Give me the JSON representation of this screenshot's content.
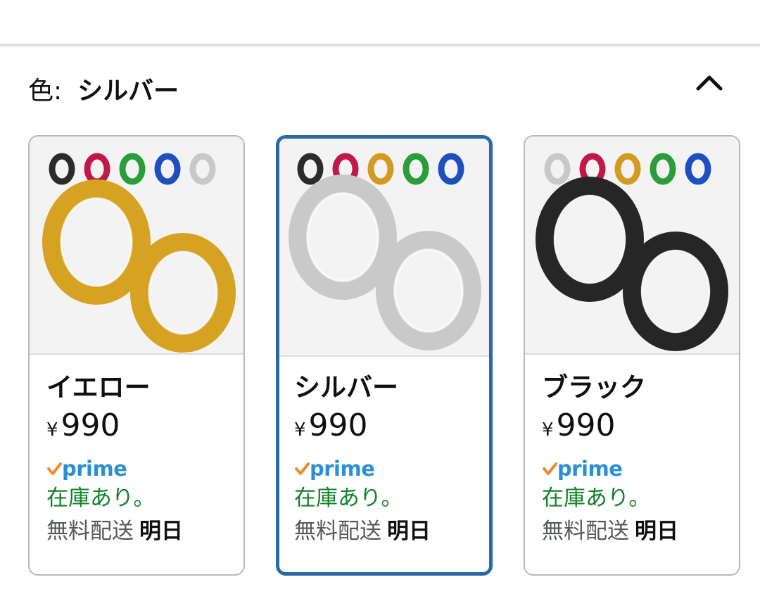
{
  "color_selector": {
    "label": "色:",
    "selected_value": "シルバー",
    "collapse_icon": "chevron-up-icon"
  },
  "variants": [
    {
      "name": "イエロー",
      "currency": "¥",
      "price": "990",
      "prime": "prime",
      "stock": "在庫あり。",
      "delivery_label": "無料配送",
      "delivery_date": "明日",
      "image_color": "#d6a222",
      "swatches": [
        "#2b2b2b",
        "#c0184a",
        "#2a9d3a",
        "#1f4fbf",
        "#c8c8c8"
      ]
    },
    {
      "name": "シルバー",
      "currency": "¥",
      "price": "990",
      "prime": "prime",
      "stock": "在庫あり。",
      "delivery_label": "無料配送",
      "delivery_date": "明日",
      "image_color": "#c9c9c9",
      "swatches": [
        "#2b2b2b",
        "#c0184a",
        "#d39a22",
        "#2a9d3a",
        "#1f4fbf"
      ],
      "selected": true
    },
    {
      "name": "ブラック",
      "currency": "¥",
      "price": "990",
      "prime": "prime",
      "stock": "在庫あり。",
      "delivery_label": "無料配送",
      "delivery_date": "明日",
      "image_color": "#262626",
      "swatches": [
        "#c8c8c8",
        "#c0184a",
        "#d39a22",
        "#2a9d3a",
        "#1f4fbf"
      ]
    }
  ],
  "colors": {
    "selected_border": "#2b69a6",
    "prime_check": "#f08a24",
    "prime_text": "#2a8fd4",
    "stock": "#128229"
  }
}
